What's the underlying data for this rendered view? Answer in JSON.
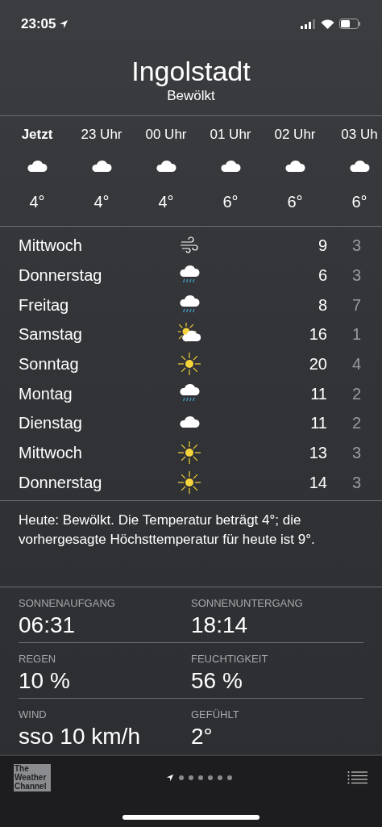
{
  "status_bar": {
    "time": "23:05"
  },
  "header": {
    "city": "Ingolstadt",
    "condition": "Bewölkt"
  },
  "hourly": [
    {
      "label": "Jetzt",
      "kind": "cloud",
      "temp": "4°",
      "selected": true
    },
    {
      "label": "23 Uhr",
      "kind": "cloud",
      "temp": "4°",
      "selected": false
    },
    {
      "label": "00 Uhr",
      "kind": "cloud",
      "temp": "4°",
      "selected": false
    },
    {
      "label": "01 Uhr",
      "kind": "cloud",
      "temp": "6°",
      "selected": false
    },
    {
      "label": "02 Uhr",
      "kind": "cloud",
      "temp": "6°",
      "selected": false
    },
    {
      "label": "03 Uh",
      "kind": "cloud",
      "temp": "6°",
      "selected": false
    }
  ],
  "daily": [
    {
      "day": "Mittwoch",
      "kind": "wind",
      "high": "9",
      "low": "3"
    },
    {
      "day": "Donnerstag",
      "kind": "rain",
      "high": "6",
      "low": "3"
    },
    {
      "day": "Freitag",
      "kind": "rain",
      "high": "8",
      "low": "7"
    },
    {
      "day": "Samstag",
      "kind": "sunny-cloud",
      "high": "16",
      "low": "1"
    },
    {
      "day": "Sonntag",
      "kind": "sun",
      "high": "20",
      "low": "4"
    },
    {
      "day": "Montag",
      "kind": "rain",
      "high": "11",
      "low": "2"
    },
    {
      "day": "Dienstag",
      "kind": "cloud",
      "high": "11",
      "low": "2"
    },
    {
      "day": "Mittwoch",
      "kind": "sun",
      "high": "13",
      "low": "3"
    },
    {
      "day": "Donnerstag",
      "kind": "sun",
      "high": "14",
      "low": "3"
    }
  ],
  "summary": "Heute: Bewölkt. Die Temperatur beträgt 4°; die vorhergesagte Höchsttemperatur für heute ist 9°.",
  "details": [
    [
      {
        "label": "SONNENAUFGANG",
        "value": "06:31"
      },
      {
        "label": "SONNENUNTERGANG",
        "value": "18:14"
      }
    ],
    [
      {
        "label": "REGEN",
        "value": "10 %"
      },
      {
        "label": "FEUCHTIGKEIT",
        "value": "56 %"
      }
    ],
    [
      {
        "label": "WIND",
        "value": "sso 10 km/h"
      },
      {
        "label": "GEFÜHLT",
        "value": "2°"
      }
    ]
  ],
  "footer": {
    "logo": "The Weather Channel",
    "pages": [
      {
        "kind": "location",
        "selected": true
      },
      {
        "kind": "dot",
        "selected": false
      },
      {
        "kind": "dot",
        "selected": false
      },
      {
        "kind": "dot",
        "selected": false
      },
      {
        "kind": "dot",
        "selected": false
      },
      {
        "kind": "dot",
        "selected": false
      },
      {
        "kind": "dot",
        "selected": false
      }
    ]
  }
}
